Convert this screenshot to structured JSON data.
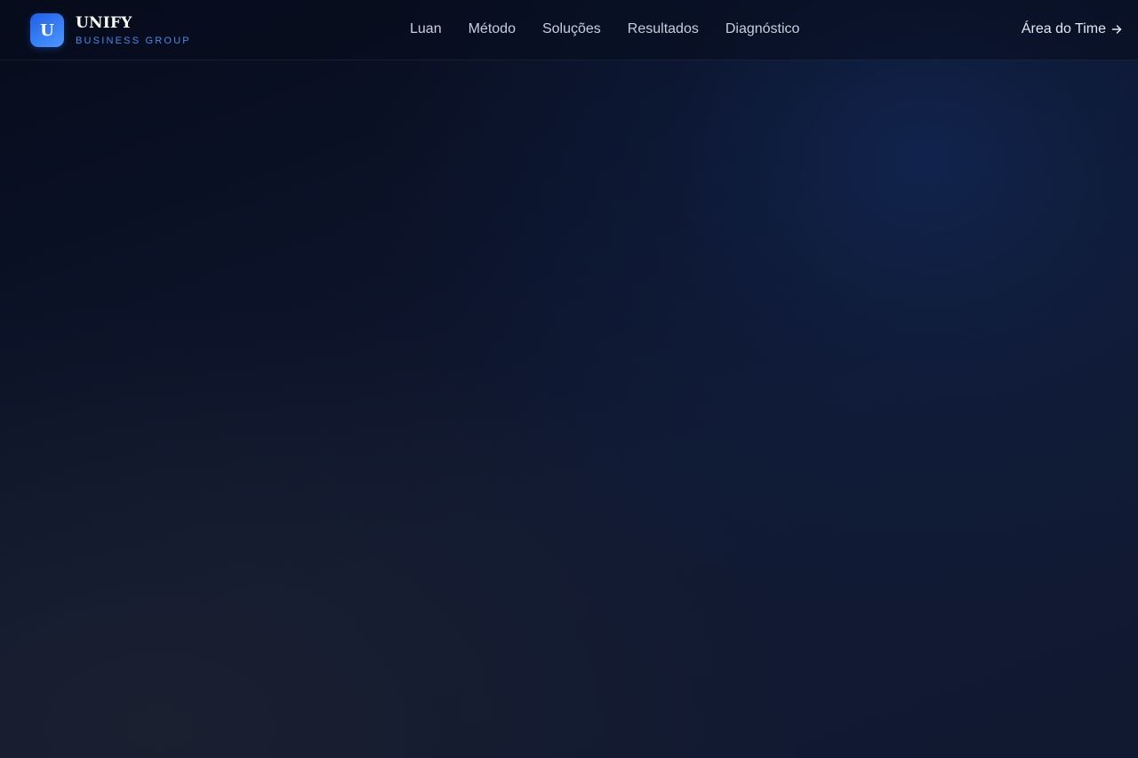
{
  "header": {
    "logo_letter": "U",
    "brand_name": "UNIFY",
    "brand_subtitle": "BUSINESS GROUP",
    "nav": [
      {
        "label": "Luan"
      },
      {
        "label": "Método"
      },
      {
        "label": "Soluções"
      },
      {
        "label": "Resultados"
      },
      {
        "label": "Diagnóstico"
      }
    ],
    "team_area_label": "Área do Time",
    "team_area_icon": "arrow-right-icon"
  },
  "colors": {
    "accent": "#3b82f6",
    "brand_subtitle": "#4f86e8",
    "background_dark": "#0c1329",
    "nav_text": "#c7cedd"
  }
}
